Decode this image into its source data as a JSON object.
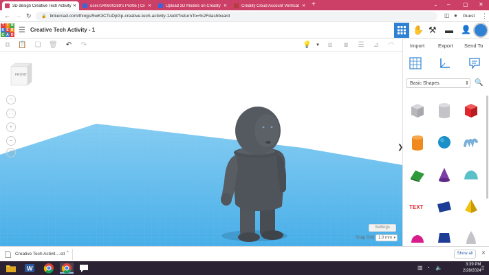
{
  "browser": {
    "tabs": [
      {
        "title": "3D design Creative Tech Activity",
        "active": true,
        "favicon_color": "#cc3f66"
      },
      {
        "title": "user7340600269's Profile | Creal",
        "active": false,
        "favicon_color": "#3a66d6"
      },
      {
        "title": "Upload 3D Models on Creality C",
        "active": false,
        "favicon_color": "#3a66d6"
      },
      {
        "title": "Creality Cloud Account Verificati",
        "active": false,
        "favicon_color": "#b43c3c"
      }
    ],
    "new_tab": "+",
    "url": "tinkercad.com/things/5wK3CTuDpGp-creative-tech-activity-1/edit?returnTo=%2Fdashboard",
    "guest_label": "Guest"
  },
  "app": {
    "logo_letters": [
      "T",
      "I",
      "N",
      "K",
      "E",
      "R",
      "C",
      "A",
      "D"
    ],
    "design_title": "Creative Tech Activity - 1"
  },
  "toolbar": {
    "import_label": "Import",
    "export_label": "Export",
    "sendto_label": "Send To"
  },
  "viewcube": {
    "face_label": "FRONT"
  },
  "viewport": {
    "settings_label": "Settings",
    "snap_grid_label": "Snap Grid",
    "snap_grid_value": "1.0 mm"
  },
  "shapes_panel": {
    "category": "Basic Shapes",
    "shapes": [
      {
        "name": "box-hole",
        "color": "#b8b8bc"
      },
      {
        "name": "cylinder-hole",
        "color": "#c4c4c8"
      },
      {
        "name": "box",
        "color": "#e0262b"
      },
      {
        "name": "cylinder",
        "color": "#f08a1c"
      },
      {
        "name": "sphere",
        "color": "#1b8fc8"
      },
      {
        "name": "scribble",
        "color": "#7ab0d8"
      },
      {
        "name": "roof",
        "color": "#2f9a3a"
      },
      {
        "name": "cone",
        "color": "#7c3fa6"
      },
      {
        "name": "round-roof",
        "color": "#5cc0c8"
      },
      {
        "name": "text",
        "color": "#e0262b"
      },
      {
        "name": "wedge",
        "color": "#1c3c96"
      },
      {
        "name": "pyramid",
        "color": "#f1c20e"
      },
      {
        "name": "half-sphere",
        "color": "#d81d8a"
      },
      {
        "name": "polygon",
        "color": "#1c3c96"
      },
      {
        "name": "paraboloid",
        "color": "#c4c4c8"
      }
    ]
  },
  "downloads": {
    "file_name": "Creative Tech Activit....stl",
    "show_all": "Show all"
  },
  "taskbar": {
    "time": "3:39 PM",
    "date": "2/28/2024"
  },
  "colors": {
    "tab_strip": "#cc3f66",
    "grid_blue": "#4fb4ea",
    "figure_gray": "#4c5258",
    "active_view_blue": "#2f82d3"
  }
}
